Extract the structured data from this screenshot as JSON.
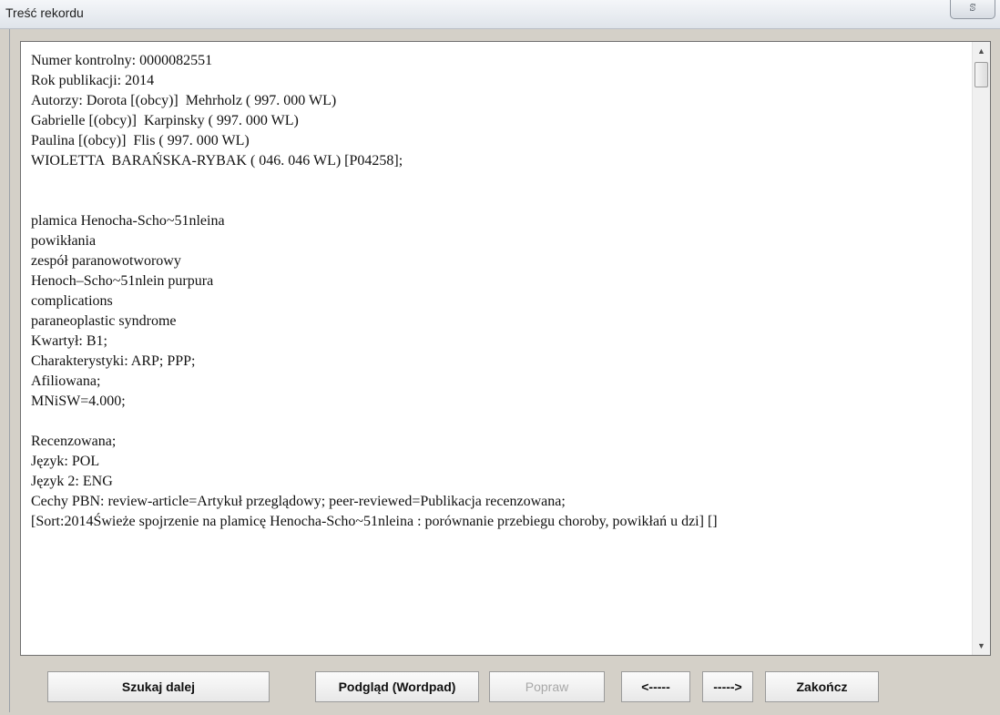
{
  "window": {
    "title": "Treść rekordu",
    "close_label": "ꕷ"
  },
  "record": {
    "lines": [
      "Numer kontrolny: 0000082551",
      "Rok publikacji: 2014",
      "Autorzy: Dorota [(obcy)]  Mehrholz ( 997. 000 WL)",
      "Gabrielle [(obcy)]  Karpinsky ( 997. 000 WL)",
      "Paulina [(obcy)]  Flis ( 997. 000 WL)",
      "WIOLETTA  BARAŃSKA-RYBAK ( 046. 046 WL) [P04258];",
      "",
      "",
      "plamica Henocha-Scho~51nleina",
      "powikłania",
      "zespół paranowotworowy",
      "Henoch–Scho~51nlein purpura",
      "complications",
      "paraneoplastic syndrome",
      "Kwartył: B1;",
      "Charakterystyki: ARP; PPP;",
      "Afiliowana;",
      "MNiSW=4.000;",
      "",
      "Recenzowana;",
      "Język: POL",
      "Język 2: ENG",
      "Cechy PBN: review-article=Artykuł przeglądowy; peer-reviewed=Publikacja recenzowana;",
      "[Sort:2014Świeże spojrzenie na plamicę Henocha-Scho~51nleina : porównanie przebiegu choroby, powikłań u dzi] []"
    ]
  },
  "buttons": {
    "search_next": "Szukaj dalej",
    "preview": "Podgląd (Wordpad)",
    "edit": "Popraw",
    "prev": "<-----",
    "next": "----->",
    "finish": "Zakończ"
  },
  "colors": {
    "dialog_bg": "#d4d0c8",
    "text_bg": "#ffffff",
    "disabled_text": "#a8a8a8"
  }
}
